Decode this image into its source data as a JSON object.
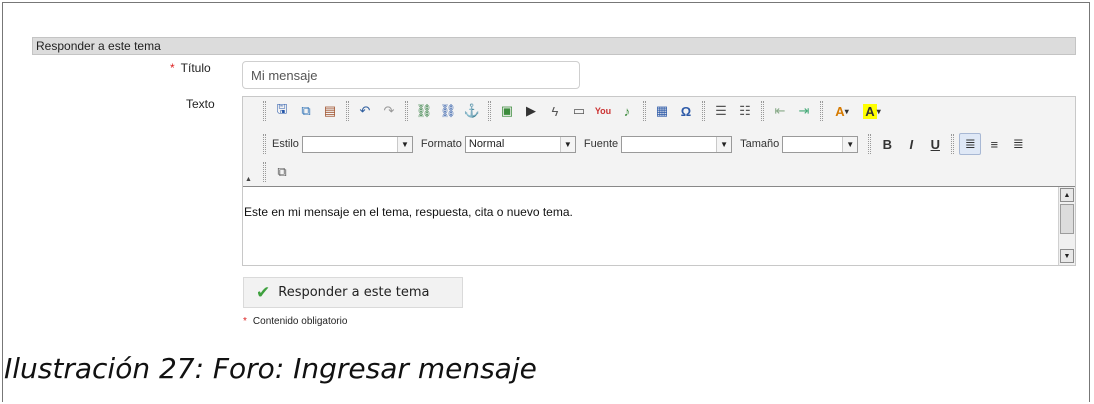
{
  "section_header": "Responder a este tema",
  "form": {
    "title_label": "Título",
    "title_value": "Mi mensaje",
    "text_label": "Texto",
    "required_mark": "*"
  },
  "toolbar": {
    "row1": [
      {
        "icon": "save-icon",
        "glyph": "🖫"
      },
      {
        "icon": "preview-icon",
        "glyph": "⧉"
      },
      {
        "icon": "paste-word-icon",
        "glyph": "📋"
      },
      {
        "icon": "undo-icon",
        "glyph": "↶"
      },
      {
        "icon": "redo-icon",
        "glyph": "↷"
      },
      {
        "icon": "link-icon",
        "glyph": "⛓"
      },
      {
        "icon": "unlink-icon",
        "glyph": "⛓"
      },
      {
        "icon": "anchor-icon",
        "glyph": "⚓"
      },
      {
        "icon": "image-icon",
        "glyph": "▣"
      },
      {
        "icon": "video-icon",
        "glyph": "▶"
      },
      {
        "icon": "flash-icon",
        "glyph": "ϟ"
      },
      {
        "icon": "media-icon",
        "glyph": "🎬"
      },
      {
        "icon": "youtube-icon",
        "glyph": "▶"
      },
      {
        "icon": "audio-icon",
        "glyph": "♪"
      },
      {
        "icon": "table-icon",
        "glyph": "▦"
      },
      {
        "icon": "special-char-icon",
        "glyph": "Ω"
      },
      {
        "icon": "numbered-list-icon",
        "glyph": "☰"
      },
      {
        "icon": "bulleted-list-icon",
        "glyph": "☷"
      },
      {
        "icon": "outdent-icon",
        "glyph": "⇤"
      },
      {
        "icon": "indent-icon",
        "glyph": "⇥"
      },
      {
        "icon": "text-color-icon",
        "glyph": "A▾"
      },
      {
        "icon": "bg-color-icon",
        "glyph": "A▾"
      }
    ],
    "style_label": "Estilo",
    "style_value": "",
    "format_label": "Formato",
    "format_value": "Normal",
    "font_label": "Fuente",
    "font_value": "",
    "size_label": "Tamaño",
    "size_value": "",
    "bold": "B",
    "italic": "I",
    "underline": "U"
  },
  "editor": {
    "content": "Este en mi mensaje en el tema, respuesta, cita o nuevo tema."
  },
  "submit_label": "Responder a este tema",
  "footnote": "Contenido obligatorio",
  "caption": "Ilustración 27: Foro: Ingresar mensaje"
}
